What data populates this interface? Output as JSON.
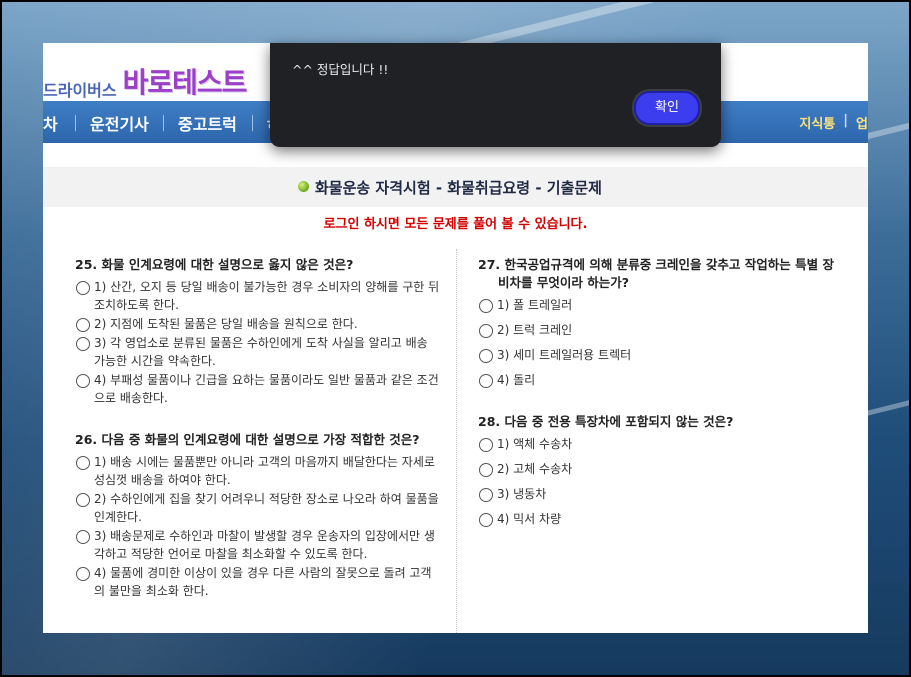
{
  "site": {
    "logo_sub": "드라이버스",
    "logo_main": "바로테스트"
  },
  "nav": {
    "items": [
      "차",
      "운전기사",
      "중고트럭",
      "ㅎ"
    ],
    "right": [
      "지식통",
      "업"
    ]
  },
  "section_title": "화물운송 자격시험 - 화물취급요령 - 기출문제",
  "login_notice": "로그인 하시면 모든 문제를 풀어 볼 수 있습니다.",
  "questions_left": [
    {
      "text": "25. 화물 인계요령에 대한 설명으로 옳지 않은 것은?",
      "options": [
        "1) 산간, 오지 등 당일 배송이 불가능한 경우 소비자의 양해를 구한 뒤 조치하도록 한다.",
        "2) 지점에 도착된 물품은 당일 배송을 원칙으로 한다.",
        "3) 각 영업소로 분류된 물품은 수하인에게 도착 사실을 알리고 배송 가능한 시간을 약속한다.",
        "4) 부패성 물품이나 긴급을 요하는 물품이라도 일반 물품과 같은 조건으로 배송한다."
      ]
    },
    {
      "text": "26. 다음 중 화물의 인계요령에 대한 설명으로 가장 적합한 것은?",
      "options": [
        "1) 배송 시에는 물품뿐만 아니라 고객의 마음까지 배달한다는 자세로 성심껏 배송을 하여야 한다.",
        "2) 수하인에게 집을 찾기 어려우니 적당한 장소로 나오라 하여 물품을 인계한다.",
        "3) 배송문제로 수하인과 마찰이 발생할 경우 운송자의 입장에서만 생각하고 적당한 언어로 마찰을 최소화할 수 있도록 한다.",
        "4) 물품에 경미한 이상이 있을 경우 다른 사람의 잘못으로 돌려 고객의 불만을 최소화 한다."
      ]
    }
  ],
  "questions_right": [
    {
      "text": "27. 한국공업규격에 의해 분류중 크레인을 갖추고 작업하는 특별 장비차를 무엇이라 하는가?",
      "options": [
        "1) 폴 트레일러",
        "2) 트럭 크레인",
        "3) 세미 트레일러용 트렉터",
        "4) 돌리"
      ]
    },
    {
      "text": "28. 다음 중 전용 특장차에 포함되지 않는 것은?",
      "options": [
        "1) 액체 수송차",
        "2) 고체 수송차",
        "3) 냉동차",
        "4) 믹서 차량"
      ]
    }
  ],
  "dialog": {
    "message": "^^ 정답입니다 !!",
    "ok_label": "확인"
  }
}
